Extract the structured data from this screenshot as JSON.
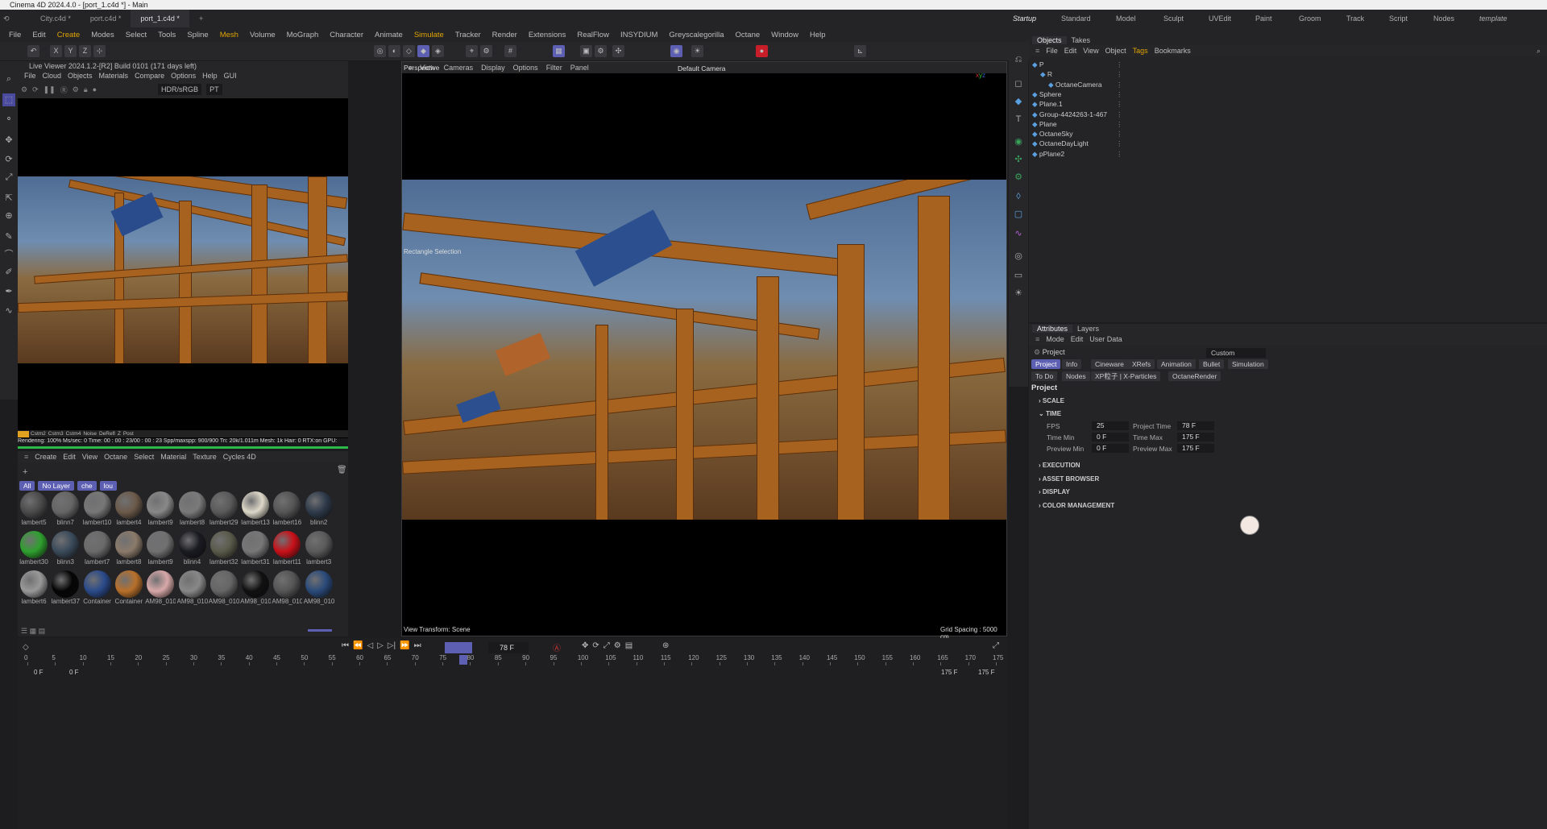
{
  "window": {
    "title": "Cinema 4D 2024.4.0 - [port_1.c4d *] - Main"
  },
  "tabs": [
    {
      "label": "City.c4d *"
    },
    {
      "label": "port.c4d *"
    },
    {
      "label": "port_1.c4d *"
    }
  ],
  "new_tab": "+",
  "layouts": [
    "Startup",
    "Standard",
    "Model",
    "Sculpt",
    "UVEdit",
    "Paint",
    "Groom",
    "Track",
    "Script",
    "Nodes",
    "template"
  ],
  "menu": [
    "File",
    "Edit",
    "Create",
    "Modes",
    "Select",
    "Tools",
    "Spline",
    "Mesh",
    "Volume",
    "MoGraph",
    "Character",
    "Animate",
    "Simulate",
    "Tracker",
    "Render",
    "Extensions",
    "RealFlow",
    "INSYDIUM",
    "Greyscalegorilla",
    "Octane",
    "Window",
    "Help"
  ],
  "live_viewer": {
    "title": "Live Viewer 2024.1.2-[R2] Build 0101 (171 days left)",
    "menu": [
      "File",
      "Cloud",
      "Objects",
      "Materials",
      "Compare",
      "Options",
      "Help",
      "GUI"
    ],
    "color_space": "HDR/sRGB",
    "mode": "PT",
    "tabs": [
      "Cstm2",
      "Cstm3",
      "Cstm4",
      "Noise",
      "DeRefl",
      "Z",
      "Post"
    ],
    "status": "Rendering: 100%   Ms/sec: 0   Time: 00 : 00 : 23/00 : 00 : 23   Spp/maxspp: 900/900   Tri: 20k/1.011m   Mesh: 1k   Hair: 0   RTX:on   GPU:"
  },
  "viewport": {
    "menu": [
      "View",
      "Cameras",
      "Display",
      "Options",
      "Filter",
      "Panel"
    ],
    "label": "Perspective",
    "camera": "Default Camera",
    "tool_label": "Rectangle Selection",
    "view_transform": "View Transform: Scene",
    "grid_spacing": "Grid Spacing : 5000 cm"
  },
  "material_manager": {
    "menu": [
      "Create",
      "Edit",
      "View",
      "Octane",
      "Select",
      "Material",
      "Texture",
      "Cycles 4D"
    ],
    "filters": [
      "All",
      "No Layer",
      "che",
      "lou"
    ],
    "materials": [
      {
        "name": "lambert5",
        "color": "#4a4a4a"
      },
      {
        "name": "blinn7",
        "color": "#666"
      },
      {
        "name": "lambert10",
        "color": "#777"
      },
      {
        "name": "lambert4",
        "color": "#6b5a4a"
      },
      {
        "name": "lambert9",
        "color": "#888"
      },
      {
        "name": "lambert8",
        "color": "#7a7a7a"
      },
      {
        "name": "lambert29",
        "color": "#5a5a5a"
      },
      {
        "name": "lambert13",
        "color": "#ddd8c8"
      },
      {
        "name": "lambert16",
        "color": "#555"
      },
      {
        "name": "blinn2",
        "color": "#2e3a4a"
      },
      {
        "name": "lambert30",
        "color": "#2ea02e"
      },
      {
        "name": "blinn3",
        "color": "#3a4a5a"
      },
      {
        "name": "lambert7",
        "color": "#6a6a6a"
      },
      {
        "name": "lambert8",
        "color": "#8a7a6a"
      },
      {
        "name": "lambert9",
        "color": "#707070"
      },
      {
        "name": "blinn4",
        "color": "#1a1a22"
      },
      {
        "name": "lambert32",
        "color": "#5a5a4a"
      },
      {
        "name": "lambert31",
        "color": "#777"
      },
      {
        "name": "lambert11",
        "color": "#c81018"
      },
      {
        "name": "lambert3",
        "color": "#5a5a5a"
      },
      {
        "name": "lambert6",
        "color": "#999"
      },
      {
        "name": "lambert37",
        "color": "#050505"
      },
      {
        "name": "Container",
        "color": "#2a4a8a"
      },
      {
        "name": "Container",
        "color": "#b8702a"
      },
      {
        "name": "AM98_010",
        "color": "#d8a8a8"
      },
      {
        "name": "AM98_010",
        "color": "#888"
      },
      {
        "name": "AM98_010",
        "color": "#666"
      },
      {
        "name": "AM98_010",
        "color": "#111"
      },
      {
        "name": "AM98_010",
        "color": "#555"
      },
      {
        "name": "AM98_010",
        "color": "#2a4a7a"
      }
    ]
  },
  "timeline": {
    "current_frame": "78 F",
    "ticks": [
      "0",
      "5",
      "10",
      "15",
      "20",
      "25",
      "30",
      "35",
      "40",
      "45",
      "50",
      "55",
      "60",
      "65",
      "70",
      "75",
      "80",
      "85",
      "90",
      "95",
      "100",
      "105",
      "110",
      "115",
      "120",
      "125",
      "130",
      "135",
      "140",
      "145",
      "150",
      "155",
      "160",
      "165",
      "170",
      "175"
    ],
    "start": "0 F",
    "start2": "0 F",
    "end": "175 F",
    "end2": "175 F"
  },
  "objects_panel": {
    "tabs": [
      "Objects",
      "Takes"
    ],
    "menu": [
      "File",
      "Edit",
      "View",
      "Object",
      "Tags",
      "Bookmarks"
    ],
    "items": [
      {
        "name": "P",
        "indent": 0
      },
      {
        "name": "R",
        "indent": 1
      },
      {
        "name": "OctaneCamera",
        "indent": 2
      },
      {
        "name": "Sphere",
        "indent": 0
      },
      {
        "name": "Plane.1",
        "indent": 0
      },
      {
        "name": "Group-4424263-1-467",
        "indent": 0
      },
      {
        "name": "Plane",
        "indent": 0
      },
      {
        "name": "OctaneSky",
        "indent": 0
      },
      {
        "name": "OctaneDayLight",
        "indent": 0
      },
      {
        "name": "pPlane2",
        "indent": 0
      }
    ]
  },
  "attributes": {
    "tabs": [
      "Attributes",
      "Layers"
    ],
    "menu": [
      "Mode",
      "Edit",
      "User Data"
    ],
    "object_label": "Project",
    "preset": "Custom",
    "tab_row1": [
      "Project",
      "Info",
      "Cineware",
      "XRefs",
      "Animation",
      "Bullet",
      "Simulation"
    ],
    "tab_row2": [
      "To Do",
      "Nodes",
      "XP粒子 | X-Particles",
      "OctaneRender"
    ],
    "heading": "Project",
    "sections": [
      "SCALE",
      "TIME",
      "EXECUTION",
      "ASSET BROWSER",
      "DISPLAY",
      "COLOR MANAGEMENT"
    ],
    "time": {
      "fps_label": "FPS",
      "fps": "25",
      "project_time_label": "Project Time",
      "project_time": "78 F",
      "time_min_label": "Time Min",
      "time_min": "0 F",
      "time_max_label": "Time Max",
      "time_max": "175 F",
      "preview_min_label": "Preview Min",
      "preview_min": "0 F",
      "preview_max_label": "Preview Max",
      "preview_max": "175 F"
    }
  }
}
